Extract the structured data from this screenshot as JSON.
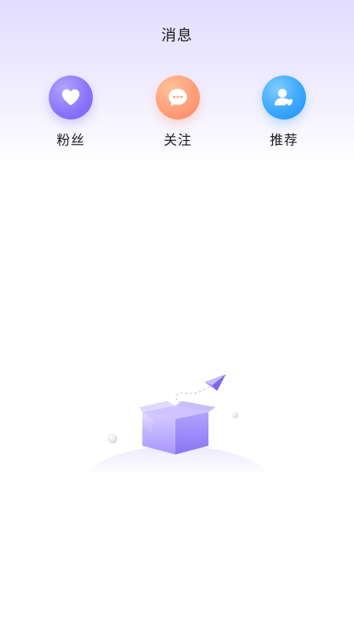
{
  "header": {
    "title": "消息"
  },
  "entries": [
    {
      "label": "粉丝",
      "icon": "heart-icon",
      "color": "#8b76ff"
    },
    {
      "label": "关注",
      "icon": "chat-bubble-icon",
      "color": "#ff9f78"
    },
    {
      "label": "推荐",
      "icon": "user-heart-icon",
      "color": "#3ba7ff"
    }
  ],
  "empty_state": {
    "illustration": "empty-box-paper-plane-icon"
  }
}
